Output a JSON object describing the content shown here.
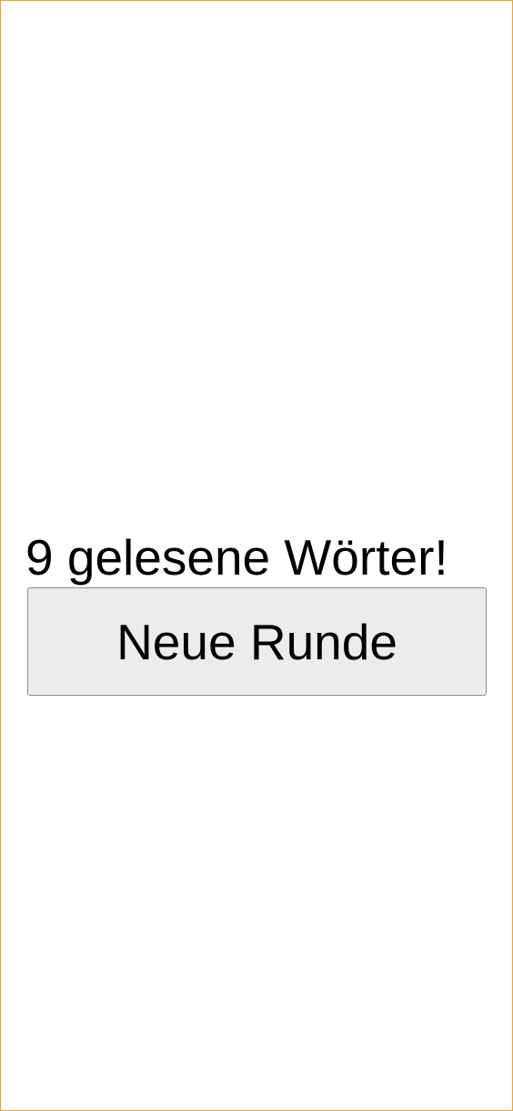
{
  "result": {
    "text": "9 gelesene Wörter!"
  },
  "actions": {
    "new_round_label": "Neue Runde"
  },
  "colors": {
    "frame_border": "#e6a23c",
    "button_background": "#ececec",
    "button_border": "#8a8a8a"
  }
}
